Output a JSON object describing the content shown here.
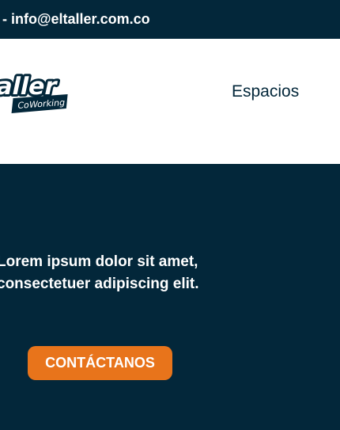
{
  "topbar": {
    "contact_text": "- info@eltaller.com.co"
  },
  "header": {
    "logo": {
      "wordmark": "aller",
      "tagline": "CoWorking"
    },
    "nav": {
      "spaces_label": "Espacios"
    }
  },
  "hero": {
    "line1": "Lorem ipsum dolor sit amet,",
    "line2": "consectetuer adipiscing elit.",
    "cta_label": "CONTÁCTANOS"
  },
  "colors": {
    "navy": "#03273a",
    "orange": "#e8741b",
    "white": "#ffffff"
  }
}
